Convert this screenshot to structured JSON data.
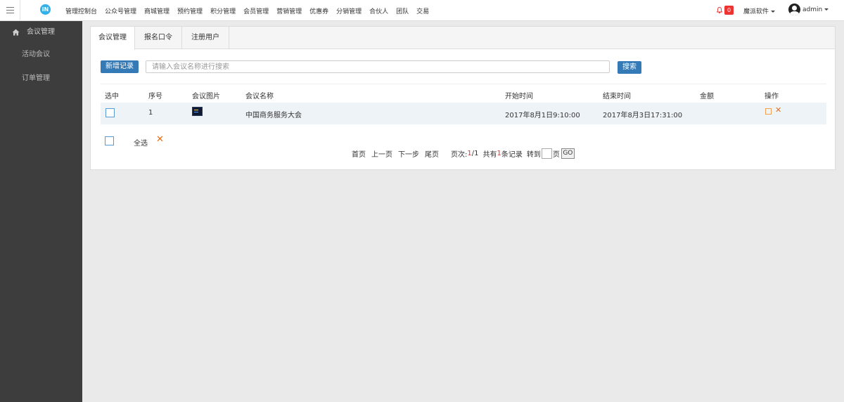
{
  "topbar": {
    "logo_text": "iN",
    "nav": [
      "管理控制台",
      "公众号管理",
      "商城管理",
      "预约管理",
      "积分管理",
      "会员管理",
      "营销管理",
      "优惠券",
      "分销管理",
      "合伙人",
      "团队",
      "交易"
    ],
    "notification_count": "0",
    "company": "魔派软件",
    "username": "admin"
  },
  "sidebar": {
    "items": [
      {
        "label": "会议管理",
        "icon": "home-icon"
      },
      {
        "label": "活动会议"
      },
      {
        "label": "订单管理"
      }
    ]
  },
  "tabs": [
    "会议管理",
    "报名口令",
    "注册用户"
  ],
  "toolbar": {
    "new_label": "新增记录",
    "search_placeholder": "请输入会议名称进行搜索",
    "search_label": "搜索"
  },
  "table": {
    "headers": [
      "选中",
      "序号",
      "会议图片",
      "会议名称",
      "开始时间",
      "结束时间",
      "金额",
      "操作"
    ],
    "rows": [
      {
        "index": "1",
        "name": "中国商务服务大会",
        "start": "2017年8月1日9:10:00",
        "end": "2017年8月3日17:31:00",
        "amount": ""
      }
    ]
  },
  "footer": {
    "select_all": "全选",
    "delete_icon": "✕"
  },
  "pager": {
    "first": "首页",
    "prev": "上一页",
    "next": "下一步",
    "last": "尾页",
    "pages_label": "页次:",
    "current": "1",
    "total_pages": "/1",
    "total_prefix": "共有",
    "total_count": "1",
    "total_suffix": "条记录",
    "goto_label": "转到",
    "page_suffix": "页",
    "go": "GO"
  },
  "colors": {
    "sidebar": "#3d3d3d",
    "primary_button": "#337ab7",
    "badge": "#e33333",
    "action": "#e07020"
  }
}
